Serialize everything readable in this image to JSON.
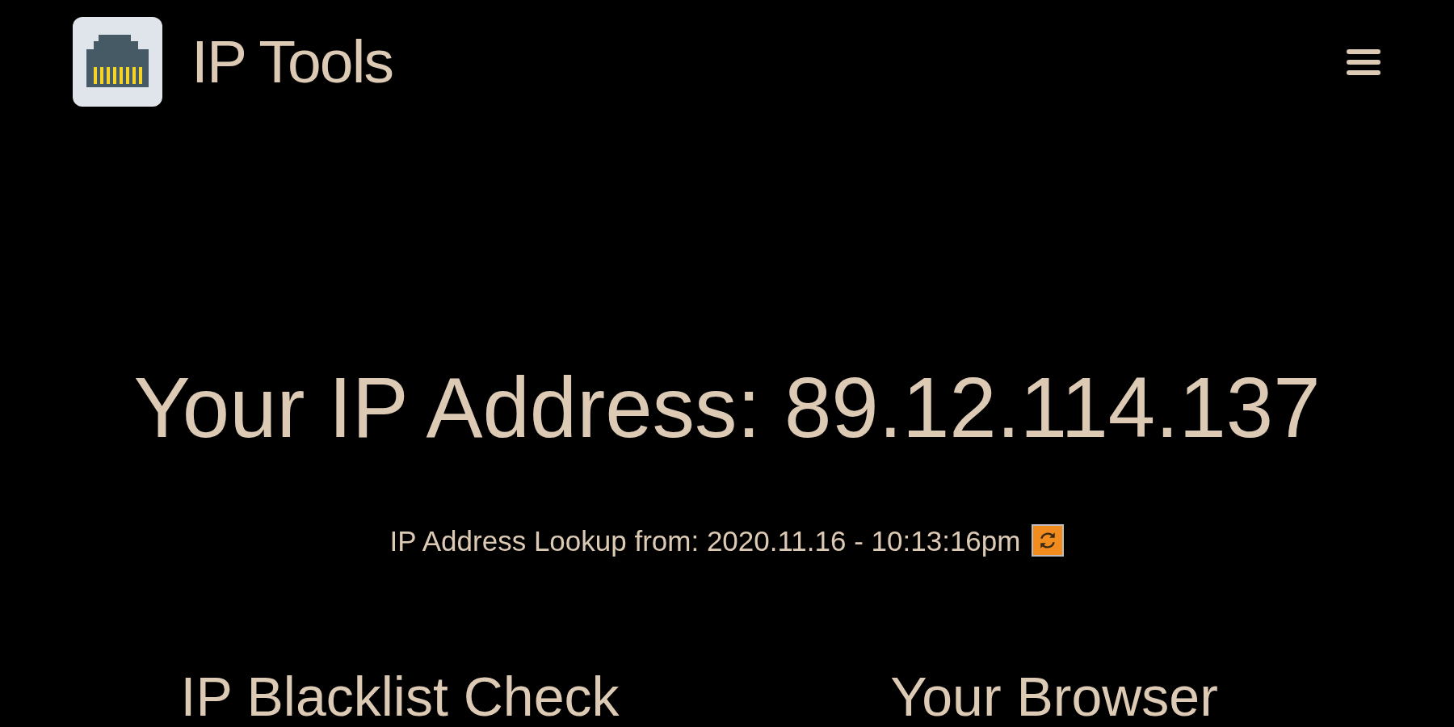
{
  "header": {
    "title": "IP Tools"
  },
  "hero": {
    "heading": "Your IP Address: 89.12.114.137",
    "lookup_text": "IP Address Lookup from: 2020.11.16 - 10:13:16pm"
  },
  "sections": [
    {
      "heading": "IP Blacklist Check"
    },
    {
      "heading": "Your Browser"
    }
  ]
}
